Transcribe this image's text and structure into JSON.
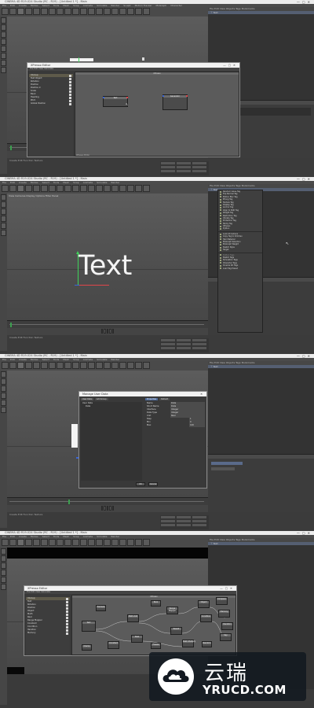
{
  "frames": [
    {
      "title": "CINEMA 4D R19.024 Studio (RC - R19) - [Untitled 1 *] - Main",
      "menu": [
        "File",
        "Edit",
        "Create",
        "Modes",
        "Select",
        "Tools",
        "Mesh",
        "Snap",
        "Animate",
        "Simulate",
        "Render",
        "Sculpt",
        "Motion Tracker",
        "MoGraph",
        "Character",
        "Pipeline",
        "Plugins",
        "Script",
        "Window",
        "Help"
      ],
      "viewport_label": "View  Cameras  Display  Options  Filter  Panel",
      "dialog": {
        "title": "XPresso Editor",
        "menu": "File  Edit  View  Calculate",
        "canvas_title": "XPresso",
        "tree_items": [
          "XGroup",
          "Text Object",
          "Rotation",
          "Position",
          "Position.X",
          "Scale",
          "Bank",
          "Heading",
          "Pitch",
          "Global Position"
        ],
        "nodes": [
          {
            "label": "Text"
          },
          {
            "label": "Generator"
          }
        ],
        "status": "XPresso Editor"
      }
    },
    {
      "title": "CINEMA 4D R19.024 Studio (RC - R19) - [Untitled 1 *] - Main",
      "text_object": "Text",
      "popup_items": [
        "Random Value Tag",
        "Flip Normal Tag",
        "Motion Blur Tag",
        "Phong Tag",
        "Texture Tag",
        "Display Tag",
        "Anchor Tag",
        "Align to Path Tag",
        "Weight Tag",
        "Restriction Tag",
        "Vibrate Tag",
        "Protection Tag",
        "Sticky Tag",
        "XPresso",
        "Python",
        "Look At Camera",
        "Copy Tag to Children",
        "Hair Material",
        "MoGraph Selection",
        "MoGraph Weight",
        "Sketch Style",
        "Target",
        "Python Tags",
        "Sketch Tags",
        "Simulation Tags",
        "Character Tags",
        "Cinema 4D Tags",
        "Load Tag Preset"
      ]
    },
    {
      "title": "CINEMA 4D R19.024 Studio (RC - R19) - [Untitled 1 *] - Main",
      "dialog": {
        "title": "Manage User Data",
        "tabs_left": [
          "User Data",
          "Add Group"
        ],
        "tree_items": [
          "User Data",
          "Data"
        ],
        "tabs_right": [
          "Properties",
          "Default"
        ],
        "props": [
          {
            "label": "Name",
            "value": "Data"
          },
          {
            "label": "Short Name",
            "value": "Data"
          },
          {
            "label": "Interface",
            "value": "Integer"
          },
          {
            "label": "Data Type",
            "value": "Integer"
          },
          {
            "label": "Unit",
            "value": "Real"
          },
          {
            "label": "Step",
            "value": "1"
          },
          {
            "label": "Min",
            "value": "0"
          },
          {
            "label": "Max",
            "value": "100"
          }
        ],
        "ok_label": "OK",
        "cancel_label": "Cancel"
      }
    },
    {
      "title": "CINEMA 4D R19.024 Studio (RC - R19) - [Untitled 1 *] - Main",
      "dialog": {
        "title": "XPresso Editor",
        "menu": "File  Edit  View  Calculate",
        "canvas_title": "XPresso",
        "tree_items": [
          "XGroup",
          "Text",
          "Rotation",
          "Position",
          "Object",
          "Math",
          "Real",
          "Range Mapper",
          "Constant",
          "Condition",
          "Iteration",
          "Memory",
          "Result",
          "Compare"
        ],
        "nodes": [
          "Text",
          "Math:Add",
          "Real",
          "Constant",
          "Range Mapper",
          "Result",
          "Object",
          "Condition",
          "Math:Multiply",
          "Compare",
          "Memory",
          "Iteration",
          "Spy",
          "Bool",
          "Formula",
          "Freeze",
          "Clamp",
          "Random"
        ]
      }
    }
  ],
  "watermark": {
    "cn": "云瑞",
    "en": "YRUCD.COM"
  },
  "colors": {
    "ui_dark": "#3a3a3a",
    "accent_green": "#3ed35a",
    "accent_red": "#e0454a",
    "accent_blue": "#3a66d8",
    "watermark_bg": "#121820"
  }
}
